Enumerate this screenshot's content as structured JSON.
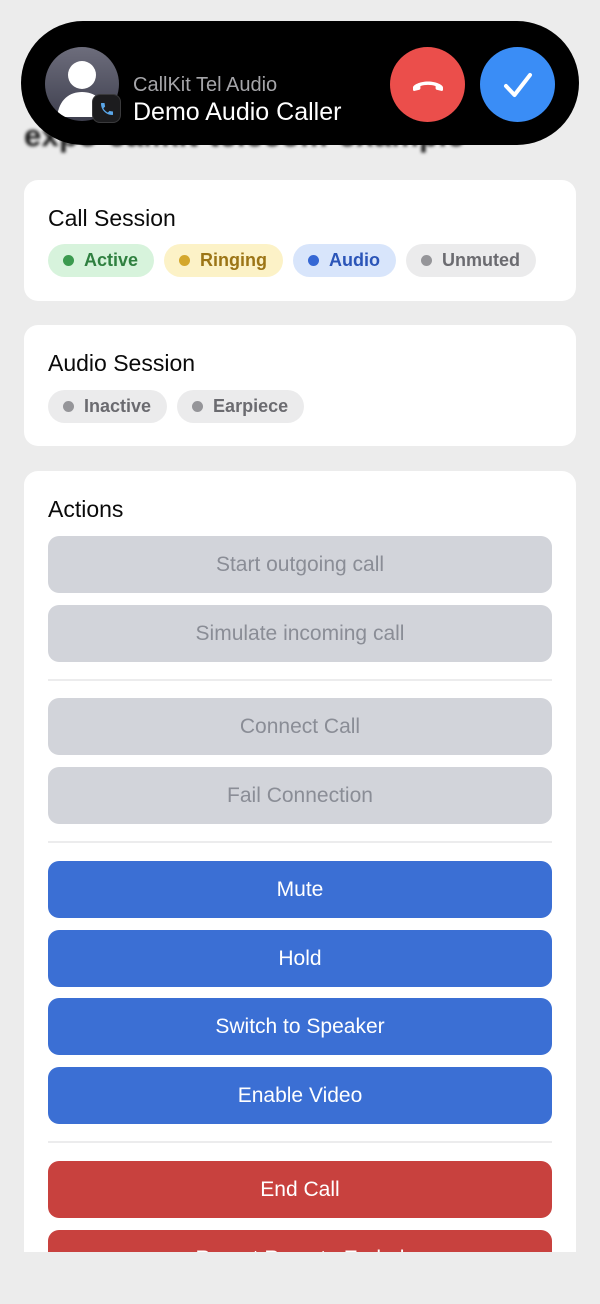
{
  "page": {
    "title": "expo-callkit-telecom-example"
  },
  "call_banner": {
    "app_name": "CallKit Tel Audio",
    "caller_name": "Demo Audio Caller",
    "decline_icon": "phone-down-icon",
    "accept_icon": "checkmark-icon",
    "decline_color": "#eb4e4b",
    "accept_color": "#3a8df6"
  },
  "call_session": {
    "title": "Call Session",
    "pills": [
      {
        "label": "Active",
        "color": "#3b9a4f"
      },
      {
        "label": "Ringing",
        "color": "#d4a72c"
      },
      {
        "label": "Audio",
        "color": "#3567d4"
      },
      {
        "label": "Unmuted",
        "color": "#959599"
      }
    ]
  },
  "audio_session": {
    "title": "Audio Session",
    "pills": [
      {
        "label": "Inactive",
        "color": "#959599"
      },
      {
        "label": "Earpiece",
        "color": "#959599"
      }
    ]
  },
  "actions": {
    "title": "Actions",
    "start_outgoing": "Start outgoing call",
    "simulate_incoming": "Simulate incoming call",
    "connect_call": "Connect Call",
    "fail_connection": "Fail Connection",
    "mute": "Mute",
    "hold": "Hold",
    "switch_speaker": "Switch to Speaker",
    "enable_video": "Enable Video",
    "end_call": "End Call",
    "report_remote_ended": "Report Remote Ended"
  },
  "colors": {
    "primary_button": "#3b6fd4",
    "destructive_button": "#c8413e",
    "disabled_button": "#d2d4da"
  }
}
